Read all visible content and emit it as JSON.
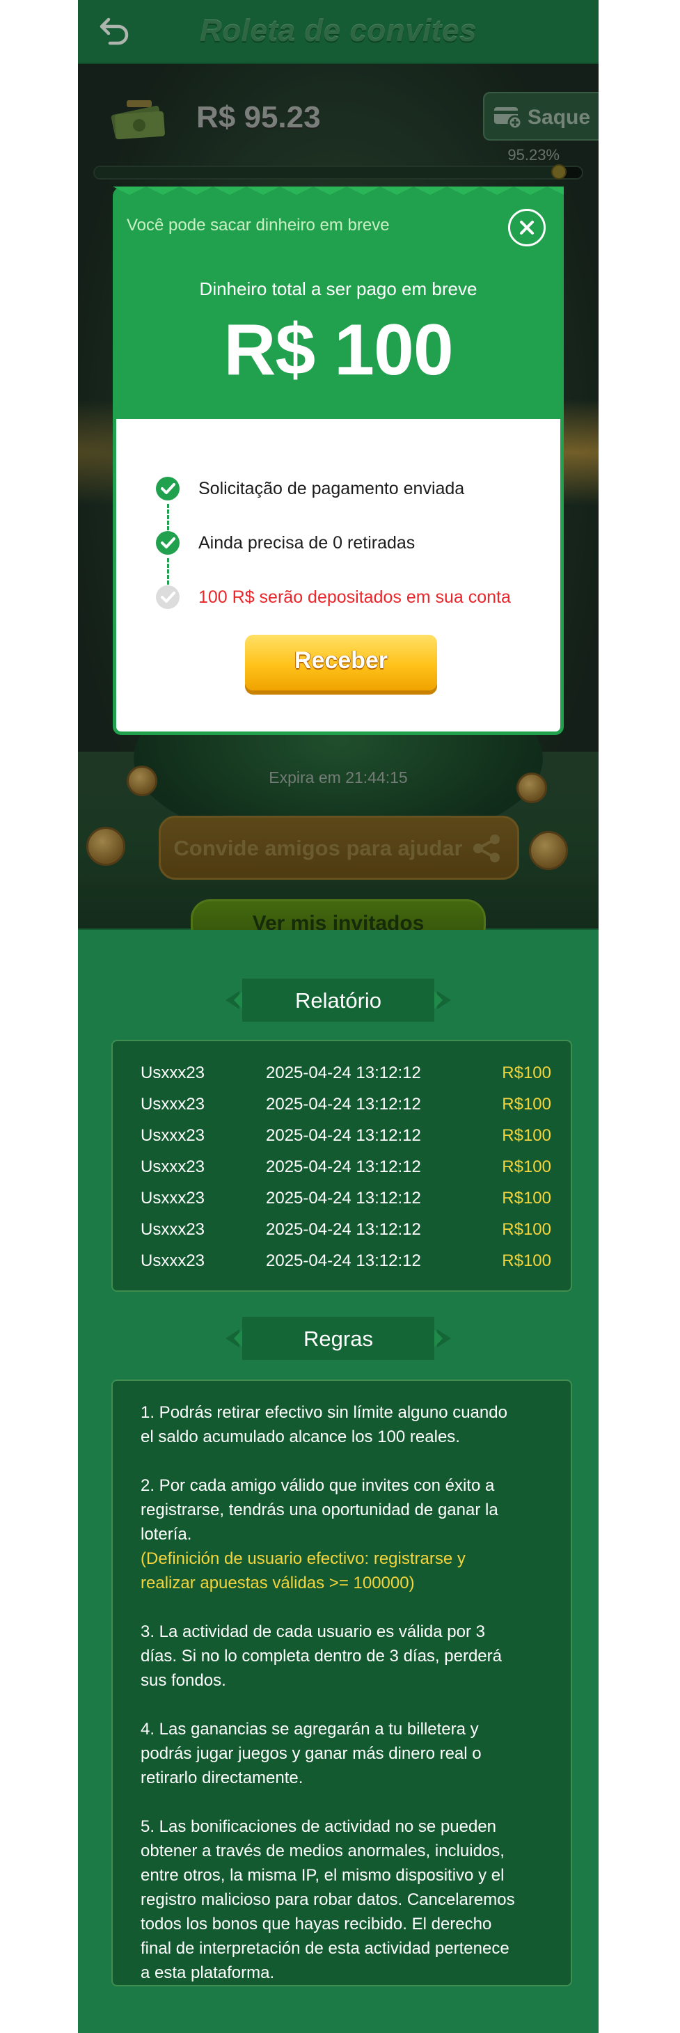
{
  "header": {
    "title": "Roleta de convites"
  },
  "wallet": {
    "balance": "R$ 95.23",
    "withdraw_label": "Saque",
    "progress_label": "95.23%",
    "progress_fraction": 0.9523
  },
  "modal": {
    "subtitle": "Você pode sacar dinheiro em breve",
    "label": "Dinheiro total a ser pago em breve",
    "amount": "R$ 100",
    "steps": [
      {
        "label": "Solicitação de pagamento enviada",
        "status": "done"
      },
      {
        "label": "Ainda precisa de 0 retiradas",
        "status": "done"
      },
      {
        "label": "100 R$ serão depositados em sua conta",
        "status": "pending"
      }
    ],
    "receive_label": "Receber"
  },
  "hero": {
    "expires": "Expira em 21:44:15",
    "invite_label": "Convide amigos para ajudar",
    "my_invites_label": "Ver mis invitados"
  },
  "report": {
    "title": "Relatório",
    "rows": [
      {
        "user": "Usxxx23",
        "date": "2025-04-24 13:12:12",
        "amount": "R$100"
      },
      {
        "user": "Usxxx23",
        "date": "2025-04-24 13:12:12",
        "amount": "R$100"
      },
      {
        "user": "Usxxx23",
        "date": "2025-04-24 13:12:12",
        "amount": "R$100"
      },
      {
        "user": "Usxxx23",
        "date": "2025-04-24 13:12:12",
        "amount": "R$100"
      },
      {
        "user": "Usxxx23",
        "date": "2025-04-24 13:12:12",
        "amount": "R$100"
      },
      {
        "user": "Usxxx23",
        "date": "2025-04-24 13:12:12",
        "amount": "R$100"
      },
      {
        "user": "Usxxx23",
        "date": "2025-04-24 13:12:12",
        "amount": "R$100"
      }
    ]
  },
  "rules": {
    "title": "Regras",
    "items": [
      {
        "lines": [
          "1. Podrás retirar efectivo sin límite alguno cuando",
          "el saldo acumulado alcance los 100 reales."
        ]
      },
      {
        "lines": [
          "2. Por cada amigo válido que invites con éxito a",
          "registrarse, tendrás una oportunidad de ganar la",
          "lotería."
        ],
        "highlight": [
          "(Definición de usuario efectivo: registrarse y",
          "realizar apuestas válidas >= 100000)"
        ]
      },
      {
        "lines": [
          "3. La actividad de cada usuario es válida por 3",
          "días. Si no lo completa dentro de 3 días, perderá",
          "sus fondos."
        ]
      },
      {
        "lines": [
          "4. Las ganancias se agregarán a tu billetera y",
          "podrás jugar juegos y ganar más dinero real o",
          "retirarlo directamente."
        ]
      },
      {
        "lines": [
          "5. Las bonificaciones de actividad no se pueden",
          "obtener a través de medios anormales, incluidos,",
          "entre otros, la misma IP, el mismo dispositivo y el",
          "registro malicioso para robar datos. Cancelaremos",
          "todos los bonos que hayas recibido. El derecho",
          "final de interpretación de esta actividad pertenece",
          "a esta plataforma."
        ]
      }
    ]
  },
  "colors": {
    "brand_green": "#1b7a45",
    "modal_green": "#21a04d",
    "accent_yellow": "#f4d43c",
    "alert_red": "#e9262a"
  }
}
